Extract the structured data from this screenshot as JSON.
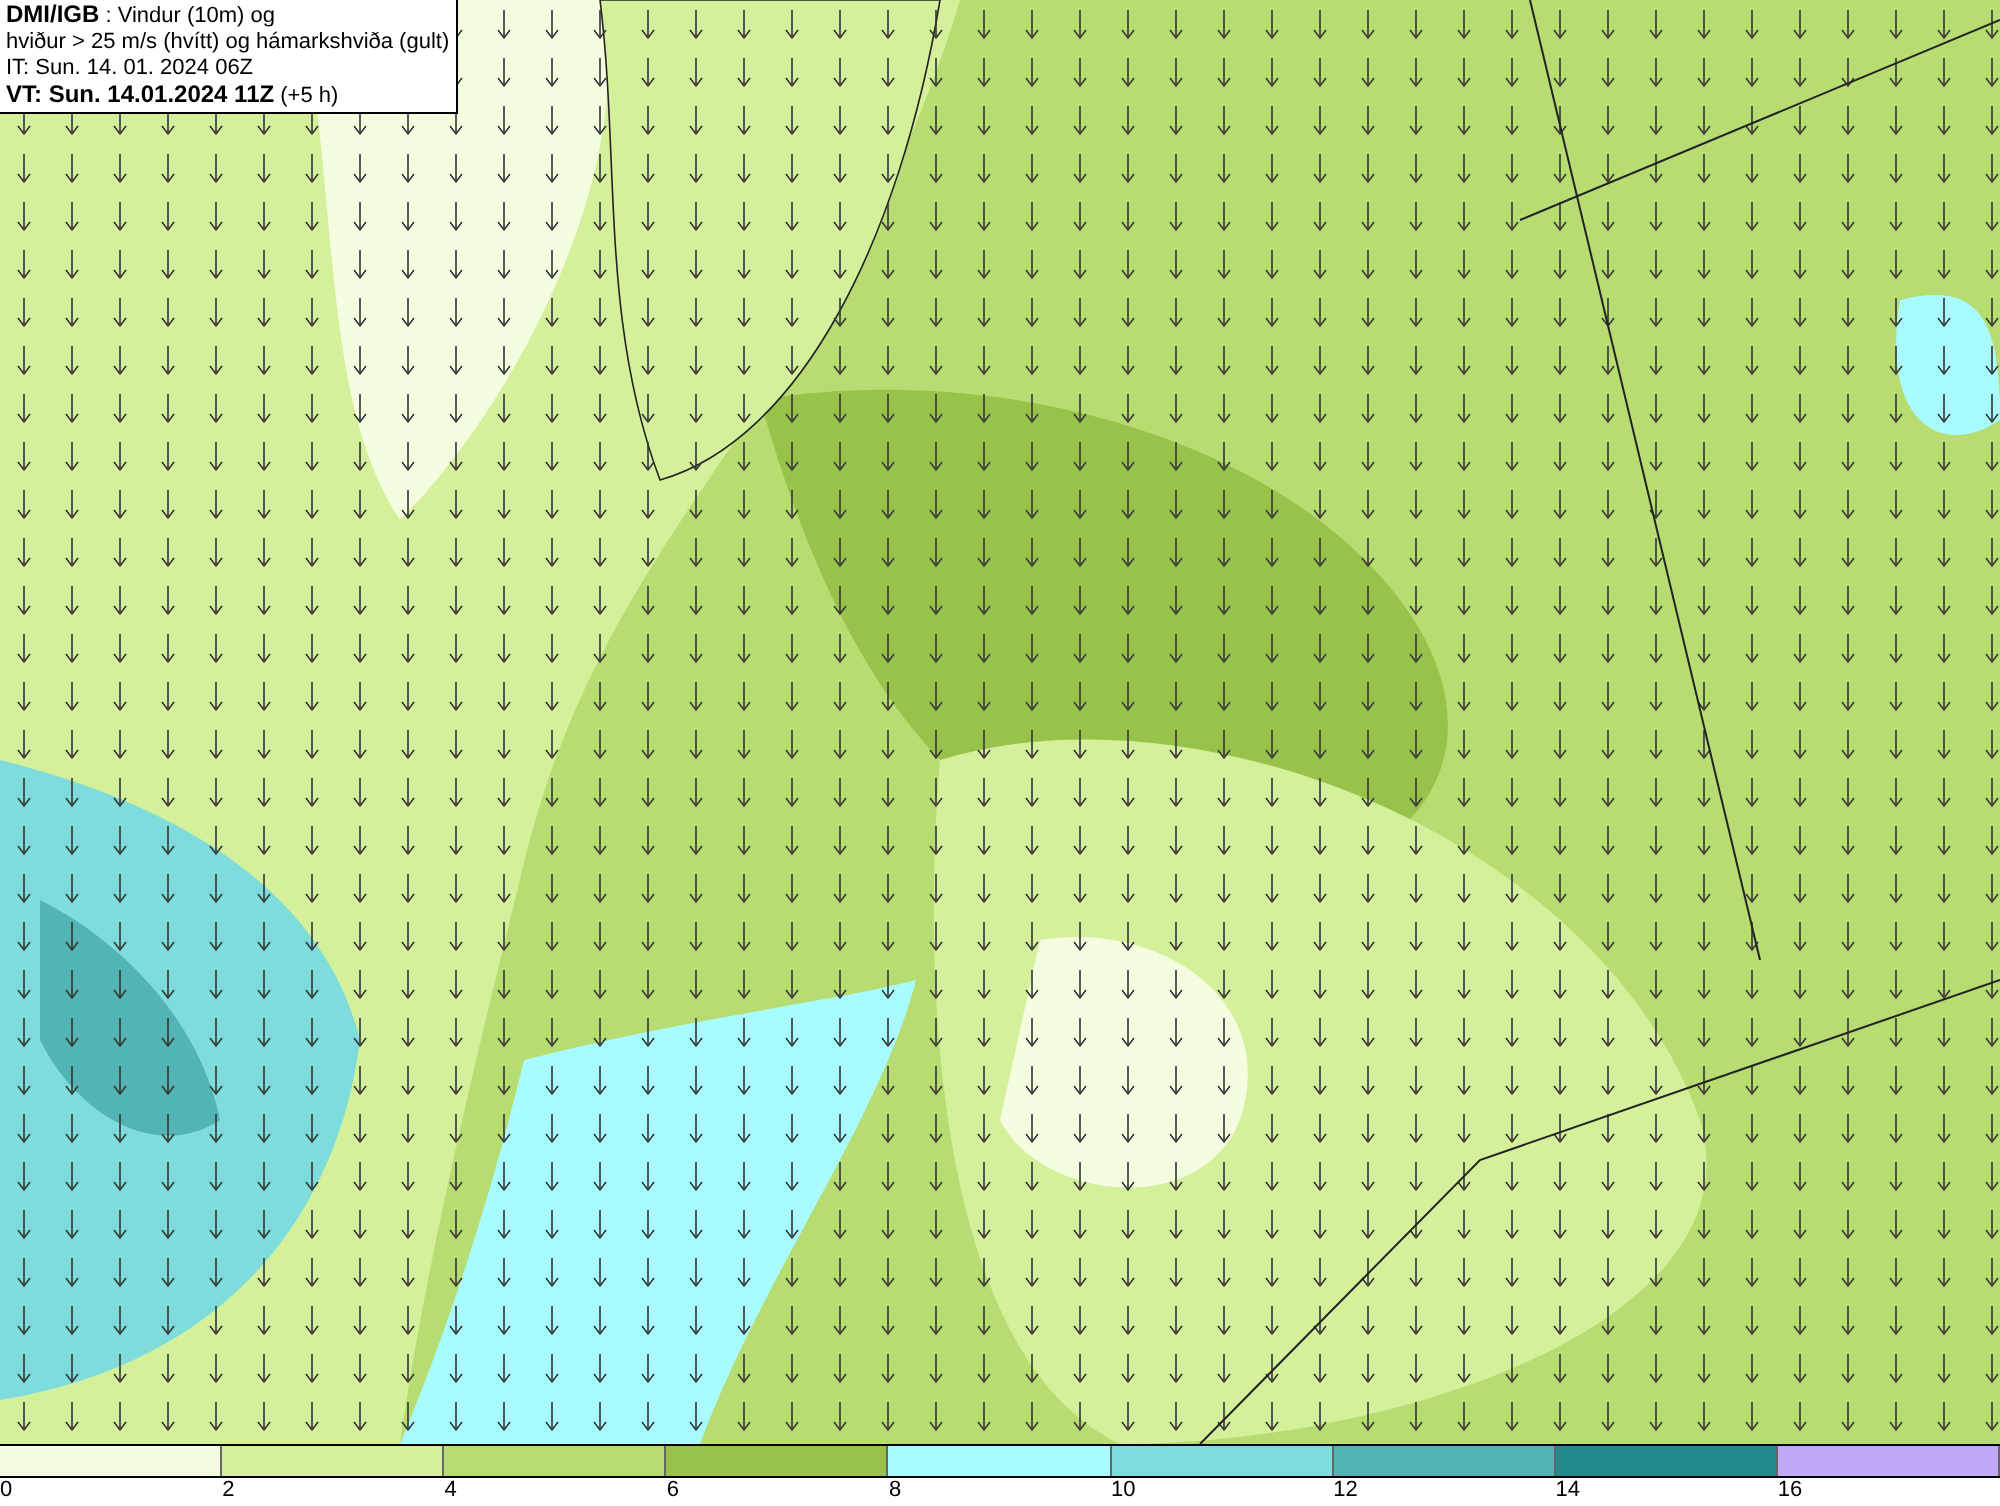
{
  "title_box": {
    "lines": [
      "**DMI/IGB** : Vindur (10m) og",
      "hviður > 25 m/s (hvítt) og hámarkshviða (gult)",
      "IT: Sun. 14. 01. 2024 06Z",
      "**VT: Sun. 14.01.2024 11Z** (+5 h)"
    ]
  },
  "legend": {
    "segments": [
      {
        "color": "#f4fde0"
      },
      {
        "color": "#d4f09a"
      },
      {
        "color": "#b7dc72"
      },
      {
        "color": "#98c24a"
      },
      {
        "color": "#a8fcff"
      },
      {
        "color": "#7fdcdc"
      },
      {
        "color": "#52b4b4"
      },
      {
        "color": "#228c8c"
      },
      {
        "color": "#c0aaf8"
      }
    ],
    "ticks": [
      "0",
      "2",
      "4",
      "6",
      "8",
      "10",
      "12",
      "14",
      "16"
    ]
  }
}
